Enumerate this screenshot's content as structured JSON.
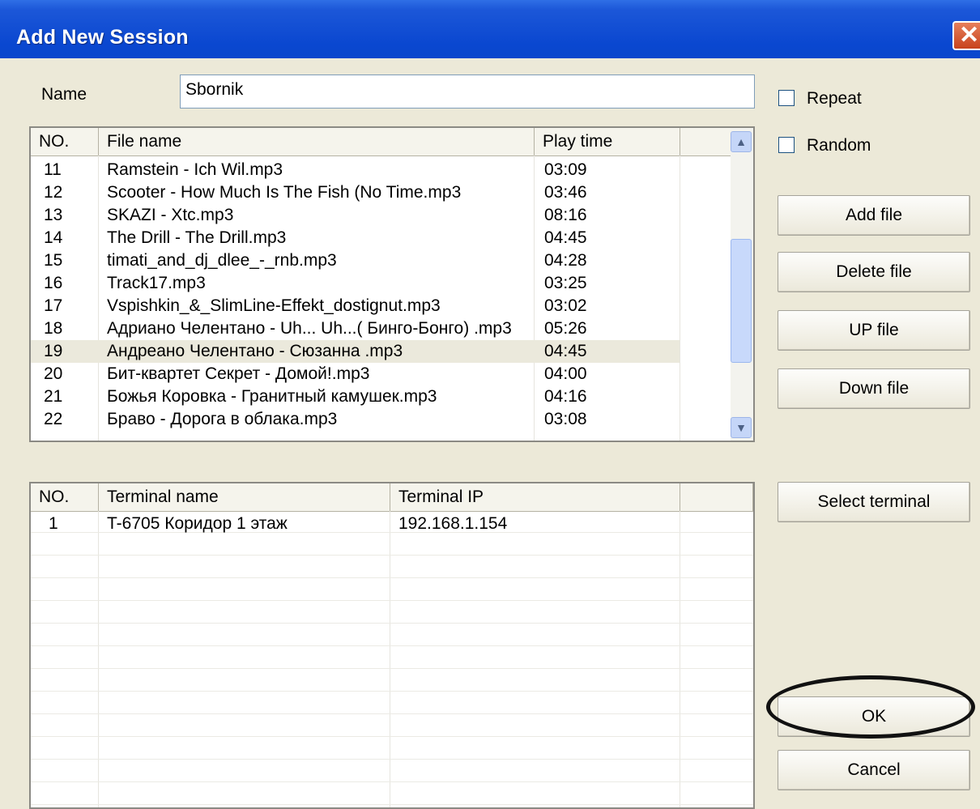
{
  "window": {
    "title": "Add New Session",
    "close_glyph": "✕"
  },
  "name_field": {
    "label": "Name",
    "value": "Sbornik"
  },
  "options": {
    "repeat_label": "Repeat",
    "repeat_checked": false,
    "random_label": "Random",
    "random_checked": false
  },
  "buttons": {
    "add_file": "Add file",
    "delete_file": "Delete file",
    "up_file": "UP file",
    "down_file": "Down file",
    "select_terminal": "Select  terminal",
    "ok": "OK",
    "cancel": "Cancel"
  },
  "files_table": {
    "headers": [
      "NO.",
      "File name",
      "Play time",
      ""
    ],
    "rows": [
      [
        "11",
        "Ramstein - Ich Wil.mp3",
        "03:09"
      ],
      [
        "12",
        "Scooter - How Much Is The Fish (No Time.mp3",
        "03:46"
      ],
      [
        "13",
        "SKAZI - Xtc.mp3",
        "08:16"
      ],
      [
        "14",
        "The  Drill -  The  Drill.mp3",
        "04:45"
      ],
      [
        "15",
        "timati_and_dj_dlee_-_rnb.mp3",
        "04:28"
      ],
      [
        "16",
        "Track17.mp3",
        "03:25"
      ],
      [
        "17",
        "Vspishkin_&_SlimLine-Effekt_dostignut.mp3",
        "03:02"
      ],
      [
        "18",
        "Адриано Челентано - Uh... Uh...( Бинго-Бонго) .mp3",
        "05:26"
      ],
      [
        "19",
        "Андреано Челентано - Сюзанна .mp3",
        "04:45"
      ],
      [
        "20",
        "Бит-квартет Секрет - Домой!.mp3",
        "04:00"
      ],
      [
        "21",
        "Божья Коровка - Гранитный камушек.mp3",
        "04:16"
      ],
      [
        "22",
        "Браво - Дорога в облака.mp3",
        "03:08"
      ]
    ],
    "selected_row": "19",
    "scroll_up_glyph": "▲",
    "scroll_down_glyph": "▼",
    "scroll_position": 0.62
  },
  "terminals_table": {
    "headers": [
      "NO.",
      "Terminal name",
      "Terminal IP",
      ""
    ],
    "rows": [
      [
        "1",
        "T-6705 Коридор 1 этаж",
        "192.168.1.154"
      ]
    ]
  },
  "annotation": {
    "highlight_color": "#111111"
  }
}
